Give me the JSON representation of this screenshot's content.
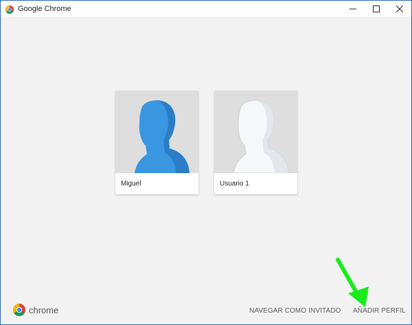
{
  "window": {
    "title": "Google Chrome",
    "controls": [
      "minimize",
      "maximize",
      "close"
    ]
  },
  "profiles": [
    {
      "name": "Miguel",
      "avatar": "blue-head-silhouette"
    },
    {
      "name": "Usuario 1",
      "avatar": "white-head-silhouette"
    }
  ],
  "footer": {
    "brand_word": "chrome",
    "guest_label": "NAVEGAR COMO INVITADO",
    "add_profile_label": "AÑADIR PERFIL"
  },
  "annotation": {
    "type": "arrow",
    "color": "#1aeb1a",
    "points_to": "add-profile-button"
  },
  "colors": {
    "background": "#f2f2f2",
    "avatar_bg": "#dedede",
    "blue_avatar": "#3a96e0",
    "white_avatar": "#f4f6f8"
  }
}
